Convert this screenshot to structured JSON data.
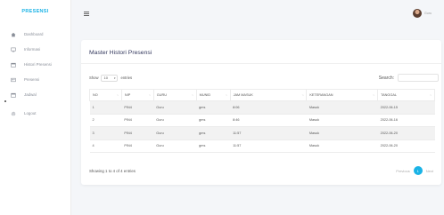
{
  "sidebar": {
    "brand": "PRESENSI",
    "items": [
      {
        "label": "Dashboard",
        "icon": "home-icon"
      },
      {
        "label": "Informasi",
        "icon": "monitor-icon"
      },
      {
        "label": "Histori Presensi",
        "icon": "calendar-icon"
      },
      {
        "label": "Presensi",
        "icon": "id-card-icon"
      },
      {
        "label": "Jadwal",
        "icon": "calendar-icon"
      },
      {
        "label": "Logout",
        "icon": "gear-icon"
      }
    ]
  },
  "topbar": {
    "username": "Guru"
  },
  "card": {
    "title": "Master Histori Presensi",
    "show_label": "Show",
    "entries_value": "10",
    "entries_label": "entries",
    "search_label": "Search:",
    "search_value": ""
  },
  "table": {
    "headers": [
      "NO",
      "NIP",
      "GURU",
      "MUNID",
      "JAM MASUK",
      "KETERANGAN",
      "TANGGAL"
    ],
    "rows": [
      [
        "1",
        "PIN4",
        "Guru",
        "gms",
        "8:06",
        "Masuk",
        "2022-06-15"
      ],
      [
        "2",
        "PIN4",
        "Guru",
        "gms",
        "8:46",
        "Masuk",
        "2022-06-16"
      ],
      [
        "3",
        "PIN4",
        "Guru",
        "gms",
        "11:57",
        "Masuk",
        "2022-06-20"
      ],
      [
        "4",
        "PIN4",
        "Guru",
        "gms",
        "11:57",
        "Masuk",
        "2022-06-20"
      ]
    ]
  },
  "footer": {
    "info": "Showing 1 to 4 of 4 entries",
    "previous": "Previous",
    "page": "1",
    "next": "Next"
  },
  "colors": {
    "accent": "#1ab3e6"
  }
}
